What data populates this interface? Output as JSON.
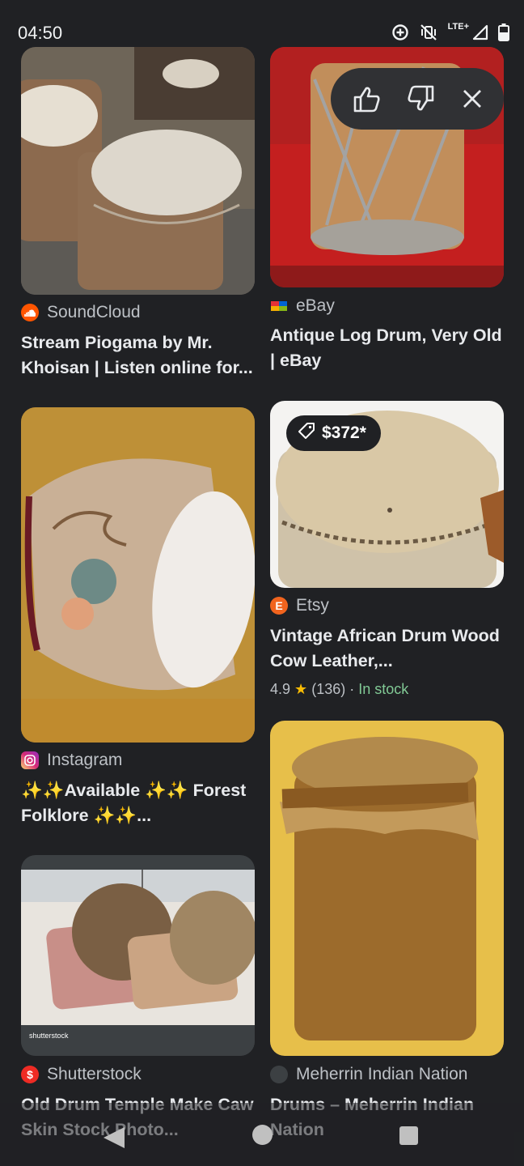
{
  "status": {
    "time": "04:50",
    "network": "LTE+"
  },
  "feedback": {
    "thumbs_up": "thumbs-up-icon",
    "thumbs_down": "thumbs-down-icon",
    "close": "close-icon"
  },
  "results": [
    {
      "source": "SoundCloud",
      "title": "Stream Piogama by Mr. Khoisan | Listen online for...",
      "favicon_color": "#ff5500"
    },
    {
      "source": "eBay",
      "title": "Antique Log Drum, Very Old | eBay",
      "favicon_color": "#e53238"
    },
    {
      "source": "Instagram",
      "title": "✨✨Available ✨✨ Forest Folklore ✨✨...",
      "favicon_color": "#d62976"
    },
    {
      "source": "Etsy",
      "title": "Vintage African Drum Wood Cow Leather,...",
      "favicon_color": "#f1641e",
      "favicon_letter": "E",
      "price": "$372*",
      "rating": "4.9",
      "reviews": "(136)",
      "stock": "In stock",
      "separator": "·"
    },
    {
      "source": "Shutterstock",
      "title": "Old Drum Temple Make Caw Skin Stock Photo...",
      "favicon_color": "#ee2b24",
      "favicon_letter": "$",
      "watermark": "shutterstock"
    },
    {
      "source": "Meherrin Indian Nation",
      "title": "Drums – Meherrin Indian Nation",
      "favicon_color": "#3c4043"
    }
  ],
  "nav": {
    "back": "back-icon",
    "home": "home-icon",
    "recents": "recents-icon"
  }
}
